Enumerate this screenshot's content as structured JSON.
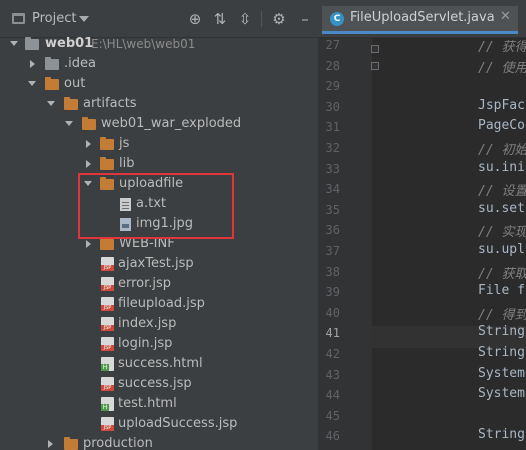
{
  "panel": {
    "title": "Project",
    "tools": [
      "target-icon",
      "collapse-all-icon",
      "expand-icon",
      "gear-icon",
      "hide-icon"
    ]
  },
  "tree": [
    {
      "label": "web01",
      "path": "E:\\HL\\web\\web01",
      "icon": "project-folder-icon",
      "bold": true
    },
    {
      "label": ".idea",
      "icon": "folder-icon"
    },
    {
      "label": "out",
      "icon": "folder-icon"
    },
    {
      "label": "artifacts",
      "icon": "folder-icon"
    },
    {
      "label": "web01_war_exploded",
      "icon": "folder-icon"
    },
    {
      "label": "js",
      "icon": "folder-icon"
    },
    {
      "label": "lib",
      "icon": "folder-icon"
    },
    {
      "label": "uploadfile",
      "icon": "folder-icon"
    },
    {
      "label": "a.txt",
      "icon": "text-file-icon"
    },
    {
      "label": "img1.jpg",
      "icon": "image-file-icon"
    },
    {
      "label": "WEB-INF",
      "icon": "folder-icon"
    },
    {
      "label": "ajaxTest.jsp",
      "icon": "jsp-file-icon"
    },
    {
      "label": "error.jsp",
      "icon": "jsp-file-icon"
    },
    {
      "label": "fileupload.jsp",
      "icon": "jsp-file-icon"
    },
    {
      "label": "index.jsp",
      "icon": "jsp-file-icon"
    },
    {
      "label": "login.jsp",
      "icon": "jsp-file-icon"
    },
    {
      "label": "success.html",
      "icon": "html-file-icon"
    },
    {
      "label": "success.jsp",
      "icon": "jsp-file-icon"
    },
    {
      "label": "test.html",
      "icon": "html-file-icon"
    },
    {
      "label": "uploadSuccess.jsp",
      "icon": "jsp-file-icon"
    },
    {
      "label": "production",
      "icon": "folder-icon"
    }
  ],
  "editor": {
    "tab_label": "FileUploadServlet.java",
    "tab_icon_letter": "C",
    "lines": [
      {
        "num": "27",
        "text": "// 获得",
        "comment": true
      },
      {
        "num": "28",
        "text": "// 使用",
        "comment": true
      },
      {
        "num": "29",
        "text": ""
      },
      {
        "num": "30",
        "text": "JspFac"
      },
      {
        "num": "31",
        "text": "PageCo"
      },
      {
        "num": "32",
        "text": "// 初始",
        "comment": true
      },
      {
        "num": "33",
        "text": "su.ini"
      },
      {
        "num": "34",
        "text": "// 设置",
        "comment": true
      },
      {
        "num": "35",
        "text": "su.set"
      },
      {
        "num": "36",
        "text": "// 实现",
        "comment": true
      },
      {
        "num": "37",
        "text": "su.upl"
      },
      {
        "num": "38",
        "text": "// 获取",
        "comment": true
      },
      {
        "num": "39",
        "text": "File f"
      },
      {
        "num": "40",
        "text": "// 得到",
        "comment": true
      },
      {
        "num": "41",
        "text": "String",
        "current": true
      },
      {
        "num": "42",
        "text": "String"
      },
      {
        "num": "43",
        "text": "System"
      },
      {
        "num": "44",
        "text": "System"
      },
      {
        "num": "45",
        "text": ""
      },
      {
        "num": "46",
        "text": "String"
      }
    ]
  }
}
